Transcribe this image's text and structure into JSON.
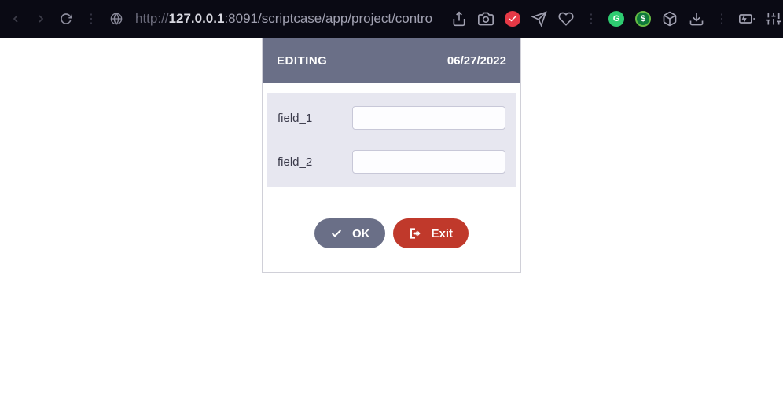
{
  "browser": {
    "url_protocol": "http://",
    "url_host": "127.0.0.1",
    "url_port": ":8091",
    "url_path": "/scriptcase/app/project/contro"
  },
  "form": {
    "title": "EDITING",
    "date": "06/27/2022",
    "fields": [
      {
        "label": "field_1",
        "value": ""
      },
      {
        "label": "field_2",
        "value": ""
      }
    ],
    "buttons": {
      "ok": "OK",
      "exit": "Exit"
    }
  }
}
